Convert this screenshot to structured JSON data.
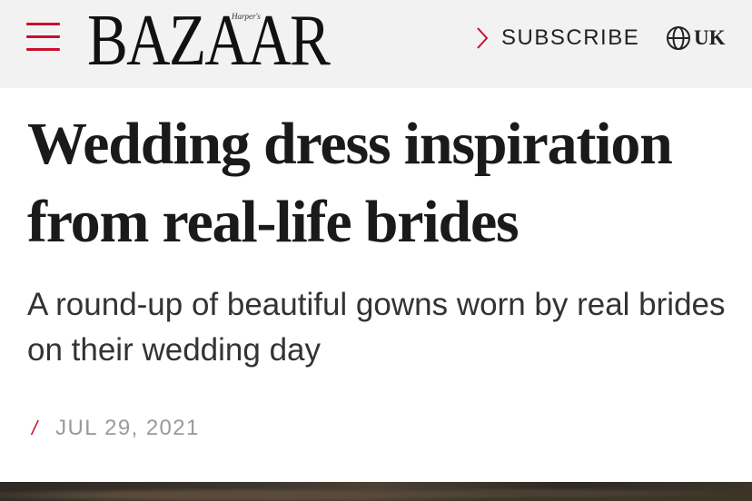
{
  "header": {
    "logo_main": "BAZAAR",
    "logo_small": "Harper's",
    "subscribe_label": "SUBSCRIBE",
    "region_label": "UK"
  },
  "article": {
    "headline": "Wedding dress inspiration from real-life brides",
    "subhead": "A round-up of beautiful gowns worn by real brides on their wedding day",
    "date_separator": "/",
    "date": "JUL 29, 2021"
  },
  "colors": {
    "accent": "#c8102e",
    "header_bg": "#f2f2f2",
    "text": "#1a1a1a",
    "date_text": "#9a9a9a"
  },
  "icons": {
    "menu": "hamburger-menu-icon",
    "subscribe": "chevron-right-icon",
    "region": "globe-icon"
  }
}
